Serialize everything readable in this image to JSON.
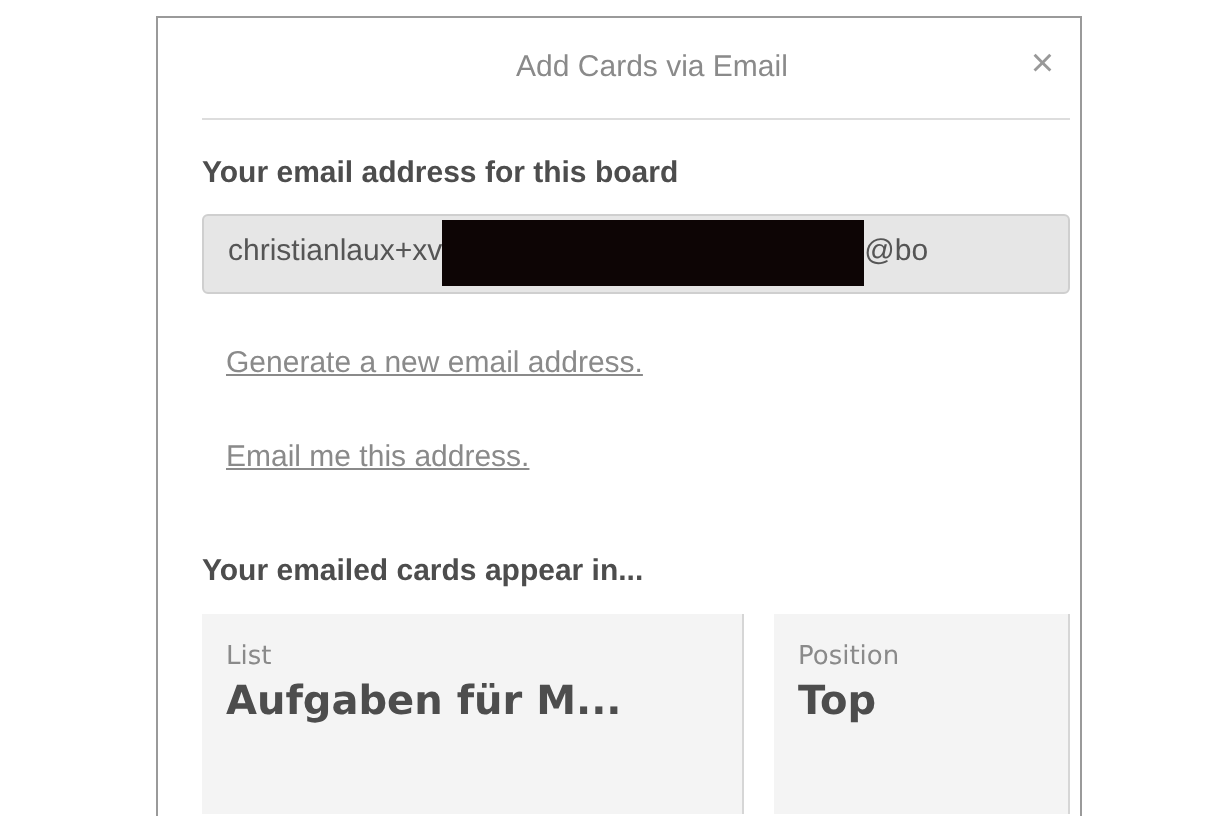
{
  "popover": {
    "title": "Add Cards via Email",
    "close": "×"
  },
  "email_section": {
    "heading": "Your email address for this board",
    "field": {
      "value_start": "christianlaux+xv",
      "value_end": "@bo",
      "redacted": true
    }
  },
  "links": [
    "Generate a new email address.",
    "Email me this address."
  ],
  "destination": {
    "heading": "Your emailed cards appear in...",
    "selects": [
      {
        "label": "List",
        "value": "Aufgaben für M..."
      },
      {
        "label": "Position",
        "value": "Top"
      }
    ]
  }
}
